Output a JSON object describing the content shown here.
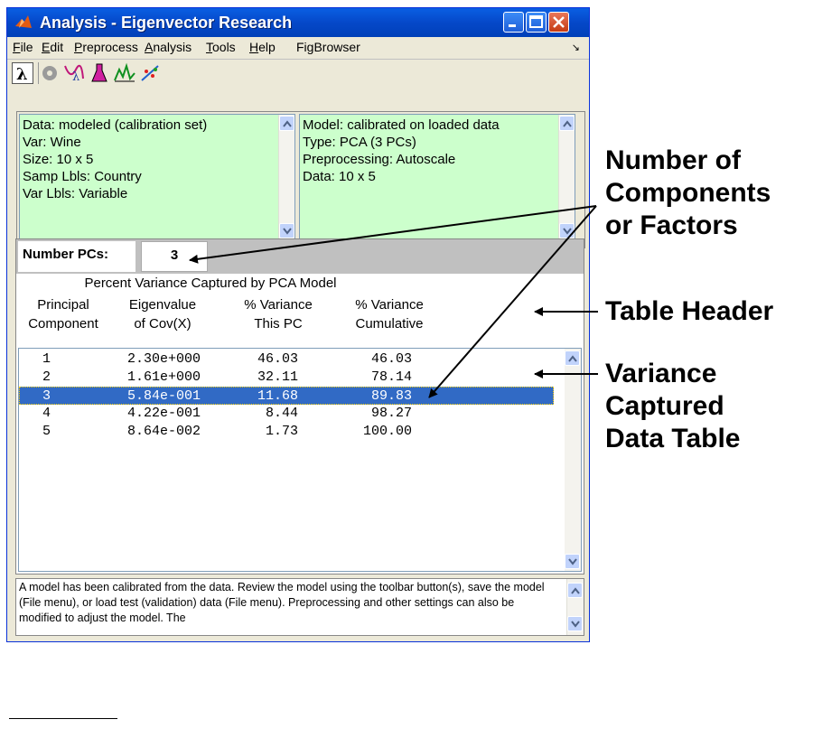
{
  "window": {
    "title": "Analysis - Eigenvector Research"
  },
  "menu": {
    "items": [
      {
        "pre": "",
        "ul": "F",
        "post": "ile"
      },
      {
        "pre": "",
        "ul": "E",
        "post": "dit"
      },
      {
        "pre": "",
        "ul": "P",
        "post": "reprocess"
      },
      {
        "pre": "",
        "ul": "A",
        "post": "nalysis"
      },
      {
        "pre": "",
        "ul": "T",
        "post": "ools"
      },
      {
        "pre": "",
        "ul": "H",
        "post": "elp"
      },
      {
        "pre": "",
        "ul": "",
        "post": "FigBrowser"
      }
    ]
  },
  "toolbar": {
    "icons": [
      "lambda-icon",
      "gear-icon",
      "lambda-curve-icon",
      "flask-icon",
      "spectra-icon",
      "scatter-icon"
    ]
  },
  "data_panel": {
    "lines": [
      "Data: modeled (calibration set)",
      "Var: Wine",
      "Size: 10 x 5",
      "Samp Lbls: Country",
      "Var Lbls: Variable"
    ]
  },
  "model_panel": {
    "lines": [
      "Model: calibrated on loaded data",
      "Type: PCA (3 PCs)",
      "Preprocessing: Autoscale",
      "Data: 10 x 5"
    ]
  },
  "pcs": {
    "label": "Number PCs:",
    "value": "3"
  },
  "table": {
    "title": "Percent Variance Captured by PCA Model",
    "headers": [
      {
        "l1": "Principal",
        "l2": "Component"
      },
      {
        "l1": "Eigenvalue",
        "l2": "of Cov(X)"
      },
      {
        "l1": "% Variance",
        "l2": "This  PC"
      },
      {
        "l1": "% Variance",
        "l2": "Cumulative"
      }
    ],
    "rows": [
      [
        "1",
        "2.30e+000",
        "46.03",
        "46.03"
      ],
      [
        "2",
        "1.61e+000",
        "32.11",
        "78.14"
      ],
      [
        "3",
        "5.84e-001",
        "11.68",
        "89.83"
      ],
      [
        "4",
        "4.22e-001",
        "8.44",
        "98.27"
      ],
      [
        "5",
        "8.64e-002",
        "1.73",
        "100.00"
      ]
    ],
    "selected_row": 3
  },
  "status": {
    "text": "A model has been calibrated from the data. Review the model using the toolbar button(s), save the model (File menu), or load test (validation) data (File menu). Preprocessing and other settings can also be modified to adjust the model. The"
  },
  "annotations": {
    "components": [
      "Number of",
      "Components",
      "or Factors"
    ],
    "header": [
      "Table Header"
    ],
    "variance": [
      "Variance",
      "Captured",
      "Data Table"
    ]
  },
  "colors": {
    "title_bar": "#0548c9",
    "info_panel_bg": "#ccffcc",
    "selection": "#316ac5",
    "window_bg": "#ece9d8"
  }
}
